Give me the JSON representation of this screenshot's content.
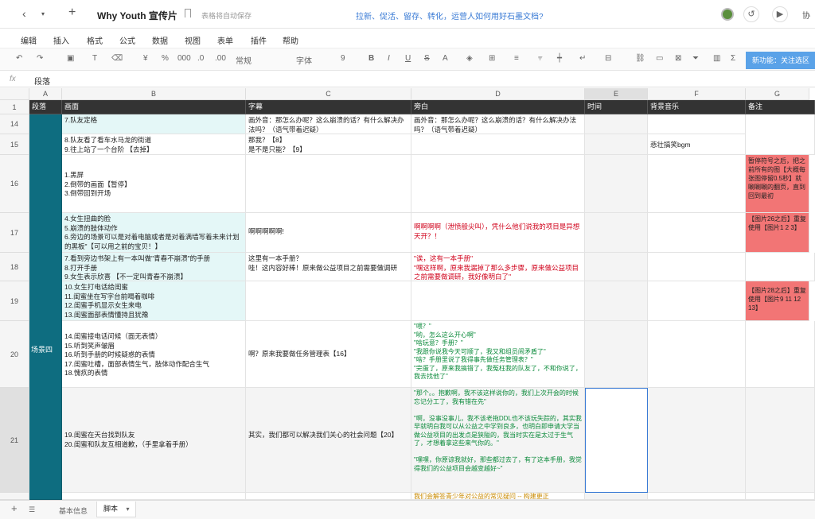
{
  "topbar": {
    "title": "Why Youth 宣传片",
    "autosave": "表格将自动保存",
    "banner": "拉新、促活、留存、转化，运营人如何用好石墨文档?",
    "collab": "协"
  },
  "menu": [
    "编辑",
    "插入",
    "格式",
    "公式",
    "数据",
    "视图",
    "表单",
    "插件",
    "帮助"
  ],
  "toolbar": {
    "currency": "¥",
    "percent": "%",
    "thousands": "000",
    "decimal_dec": ".0",
    "decimal_inc": ".00",
    "format": "常规",
    "font": "字体",
    "size": "9",
    "bold": "B",
    "italic": "I",
    "underline": "U",
    "strike": "S",
    "new_feature": "新功能：关注选区"
  },
  "formula": {
    "fx": "fx",
    "value": "段落"
  },
  "columns": [
    "A",
    "B",
    "C",
    "D",
    "E",
    "F",
    "G"
  ],
  "header_row": {
    "num": "1",
    "cells": [
      "段落",
      "画面",
      "字幕",
      "旁白",
      "时间",
      "背景音乐",
      "备注"
    ]
  },
  "rows": [
    {
      "num": "14",
      "b": "7.队友定格",
      "c": "画外音：那怎么办呢？这么崩溃的话？有什么解决办法吗？（语气带着迟疑）",
      "d": "画外音：那怎么办呢？这么崩溃的话？有什么解决办法吗？（语气带着迟疑）",
      "f": "",
      "g": ""
    },
    {
      "num": "15",
      "b": "8.队友看了看车水马龙的街道\n9.往上站了一个台阶 【去掉】",
      "c": "那我？【8】\n是不是只能？【9】",
      "d": "",
      "f": "悲壮搞笑bgm",
      "g": ""
    },
    {
      "num": "16",
      "b": "1.黑屏\n2.倒带的画面【暂停】\n3.倒带回到开场",
      "c": "",
      "d": "",
      "f": "",
      "g": "暂停符号之后，把之前所有的图【大概每张图停留0.5秒】就唰唰唰的翻页，直到回到最初"
    },
    {
      "num": "17",
      "b": "4.女生扭曲的脸\n5.崩溃的肢体动作\n6.旁边的场景可以是对着电脑或者是对着满墙写着未来计划的黑板\"【可以用之前的宝贝！】",
      "c": "啊啊啊啊啊!",
      "d": "啊啊啊啊（泄愤般尖叫），凭什么他们说我的项目是异想天开？！",
      "f": "",
      "g": "【图片26之后】重复使用【图片1 2 3】"
    },
    {
      "num": "18",
      "b": "7.看到旁边书架上有一本叫做\"青春不崩溃\"的手册\n8.打开手册\n9.女生表示欣喜 【不一定叫青春不崩溃】",
      "c": "这里有一本手册？\n哇！这内容好棒！原来做公益项目之前需要做调研",
      "d": "\"诶，这有一本手册\"\n\"嘿这样啊，原来我漏掉了那么多步骤，原来做公益项目之前需要做调研，我好像明白了\"",
      "f": "",
      "g": ""
    },
    {
      "num": "19",
      "b": "10.女生打电话给闺蜜\n11.闺蜜坐在写字台前喝着咖啡\n12.闺蜜手机显示女生来电\n13.闺蜜面部表情懂持且犹豫",
      "c": "",
      "d": "",
      "f": "",
      "g": "【图片28之后】重复使用【图片9 11 12 13】"
    },
    {
      "num": "20",
      "b": "14.闺蜜接电话问候（面无表情）\n15.听到笑声皱眉\n16.听到手册的时候疑惑的表情\n17.闺蜜吐槽，面部表情生气，肢体动作配合生气\n18.愧疚的表情",
      "c": "啊？原来我要做任务管理表【16】",
      "d": "\"喂？\"\n\"哟，怎么这么开心啊\"\n\"啥玩意？手册？\"\n\"我跟你说我今天可顺了，我又和组员闹矛盾了\"\n\"啥？手册里说了我得事先做任务管理表？\"\n\"完蛋了，原来我搞错了，我冤枉我的队友了，不和你说了，我去找他了\"",
      "f": "",
      "g": ""
    },
    {
      "num": "21",
      "b": "19.闺蜜在天台找到队友\n20.闺蜜和队友互相道歉，（手里拿着手册）",
      "c": "其实，我们都可以解决我们关心的社会问题【20】",
      "d": "\"那个。。抱歉啊，我不该这样说你的，我们上次开会的时候忘记分工了，我有错在先\"\n\n\"啊，没事没事儿，我不该老拖DDL也不该玩失踪的，其实我早就明白我可以从公益之中学到良多，也明白即申请大学当做公益项目的出发点是狭隘的，我当时实在是太过于生气了，才想着拿这些来气你的。\"\n\n\"嘿嘿，你原谅我就好，那些都过去了，有了这本手册，我觉得我们的公益项目会越变越好~\"",
      "f": "",
      "g": ""
    },
    {
      "num": "22",
      "b": "",
      "c": "",
      "d": "我们会解答青少年对公益的常见疑问 -- 构建更正",
      "f": "",
      "g": ""
    }
  ],
  "scene_label": "场景四",
  "sheets": {
    "tab1": "基本信息",
    "tab2": "脚本"
  }
}
